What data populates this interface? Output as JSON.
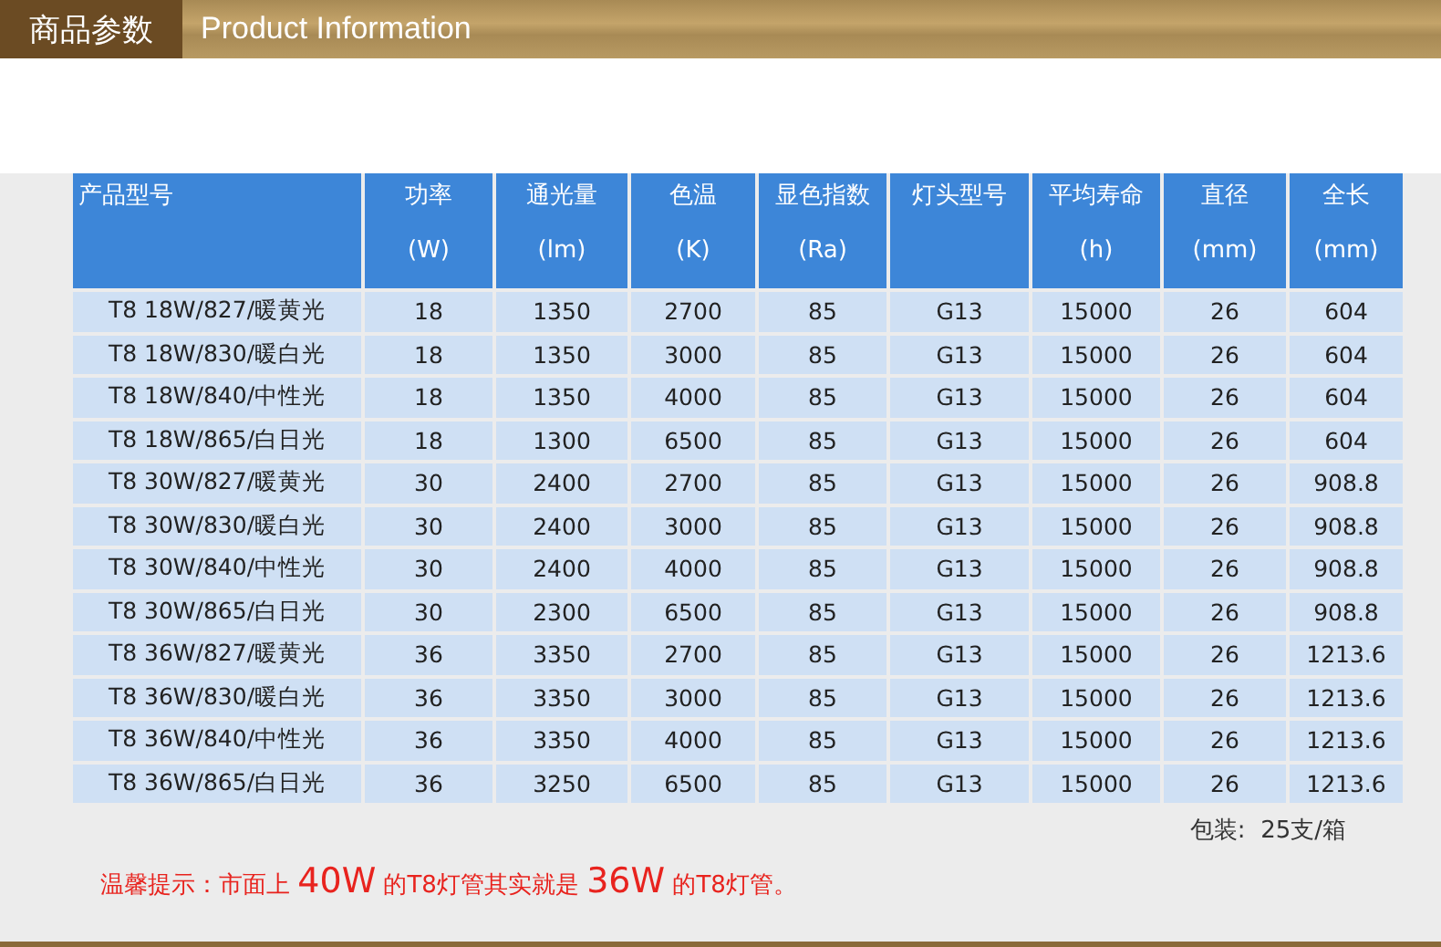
{
  "banner": {
    "title": "商品参数",
    "subtitle": "Product Information"
  },
  "table": {
    "columns": [
      {
        "label": "产品型号"
      },
      {
        "label": "功率",
        "unit": "(W)"
      },
      {
        "label": "通光量",
        "unit": "(lm)"
      },
      {
        "label": "色温",
        "unit": "(K)"
      },
      {
        "label": "显色指数",
        "unit": "(Ra)"
      },
      {
        "label": "灯头型号"
      },
      {
        "label": "平均寿命",
        "unit": "(h)"
      },
      {
        "label": "直径",
        "unit": "(mm)"
      },
      {
        "label": "全长",
        "unit": "(mm)"
      }
    ],
    "rows": [
      [
        "T8 18W/827/暖黄光",
        "18",
        "1350",
        "2700",
        "85",
        "G13",
        "15000",
        "26",
        "604"
      ],
      [
        "T8 18W/830/暖白光",
        "18",
        "1350",
        "3000",
        "85",
        "G13",
        "15000",
        "26",
        "604"
      ],
      [
        "T8 18W/840/中性光",
        "18",
        "1350",
        "4000",
        "85",
        "G13",
        "15000",
        "26",
        "604"
      ],
      [
        "T8 18W/865/白日光",
        "18",
        "1300",
        "6500",
        "85",
        "G13",
        "15000",
        "26",
        "604"
      ],
      [
        "T8 30W/827/暖黄光",
        "30",
        "2400",
        "2700",
        "85",
        "G13",
        "15000",
        "26",
        "908.8"
      ],
      [
        "T8 30W/830/暖白光",
        "30",
        "2400",
        "3000",
        "85",
        "G13",
        "15000",
        "26",
        "908.8"
      ],
      [
        "T8 30W/840/中性光",
        "30",
        "2400",
        "4000",
        "85",
        "G13",
        "15000",
        "26",
        "908.8"
      ],
      [
        "T8 30W/865/白日光",
        "30",
        "2300",
        "6500",
        "85",
        "G13",
        "15000",
        "26",
        "908.8"
      ],
      [
        "T8 36W/827/暖黄光",
        "36",
        "3350",
        "2700",
        "85",
        "G13",
        "15000",
        "26",
        "1213.6"
      ],
      [
        "T8 36W/830/暖白光",
        "36",
        "3350",
        "3000",
        "85",
        "G13",
        "15000",
        "26",
        "1213.6"
      ],
      [
        "T8 36W/840/中性光",
        "36",
        "3350",
        "4000",
        "85",
        "G13",
        "15000",
        "26",
        "1213.6"
      ],
      [
        "T8 36W/865/白日光",
        "36",
        "3250",
        "6500",
        "85",
        "G13",
        "15000",
        "26",
        "1213.6"
      ]
    ]
  },
  "packing": "包装:  25支/箱",
  "notice": [
    {
      "text": "温馨提示：市面上 ",
      "large": false
    },
    {
      "text": "40W",
      "large": true
    },
    {
      "text": " 的T8灯管其实就是 ",
      "large": false
    },
    {
      "text": "36W",
      "large": true
    },
    {
      "text": " 的T8灯管。",
      "large": false
    }
  ]
}
